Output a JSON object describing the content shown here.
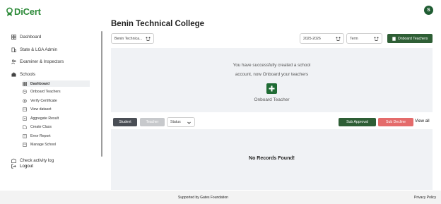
{
  "app": {
    "logo_text": "DiCert",
    "avatar_initial": "S"
  },
  "sidebar": {
    "items": [
      {
        "label": "Dashboard",
        "icon": "dashboard-icon"
      },
      {
        "label": "State & LGA Admin",
        "icon": "building-icon"
      },
      {
        "label": "Examiner & Inspectors",
        "icon": "users-icon"
      },
      {
        "label": "Schools",
        "icon": "school-icon"
      }
    ],
    "subitems": [
      {
        "label": "Dashboard",
        "icon": "dashboard-icon",
        "active": true
      },
      {
        "label": "Onboard Teachers",
        "icon": "database-icon"
      },
      {
        "label": "Verify Certificate",
        "icon": "certificate-icon"
      },
      {
        "label": "View dataset",
        "icon": "dataset-icon"
      },
      {
        "label": "Aggregate Result",
        "icon": "result-icon"
      },
      {
        "label": "Create Class",
        "icon": "class-icon"
      },
      {
        "label": "Error Report",
        "icon": "report-icon"
      },
      {
        "label": "Manage School",
        "icon": "manage-icon"
      }
    ],
    "activity_log": "Check activity log",
    "logout": "Logout"
  },
  "header": {
    "title": "Benin Technical College",
    "school_select": "Benin Technica...",
    "session_select": "2025-2026",
    "term_select": "Term",
    "onboard_button": "Onboard Teachers"
  },
  "success_panel": {
    "message_line1": "You have successfully created a school",
    "message_line2": "account, now Onboard your teachers",
    "onboard_label": "Onboard Teacher"
  },
  "records": {
    "tab_student": "Student",
    "tab_teacher": "Teacher",
    "status_select": "Status",
    "sub_approval": "Sub Approval",
    "sub_decline": "Sub Decline",
    "view_all": "View all",
    "empty_text": "No Records Found!"
  },
  "footer": {
    "supported_by": "Supported by Gates Foundation",
    "privacy": "Privacy Policy"
  },
  "colors": {
    "brand_green": "#2e8b3a",
    "dark_green": "#2e5e35",
    "decline_red": "#e46b6b",
    "student_tab": "#4a4e55",
    "teacher_tab": "#c7c9cc"
  }
}
